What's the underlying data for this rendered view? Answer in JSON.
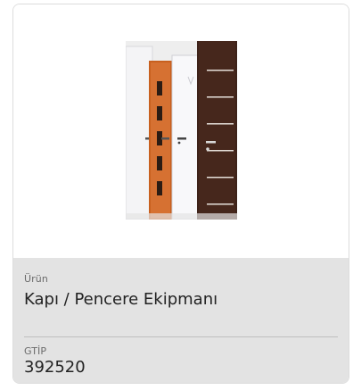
{
  "product_image": {
    "icon": "door-photo",
    "colors": {
      "white_door": "#f1f1f3",
      "wood_door": "#d06a2a",
      "dark_door": "#3a1f17"
    }
  },
  "product": {
    "label": "Ürün",
    "value": "Kapı / Pencere Ekipmanı"
  },
  "gtip": {
    "label": "GTİP",
    "value": "392520"
  }
}
